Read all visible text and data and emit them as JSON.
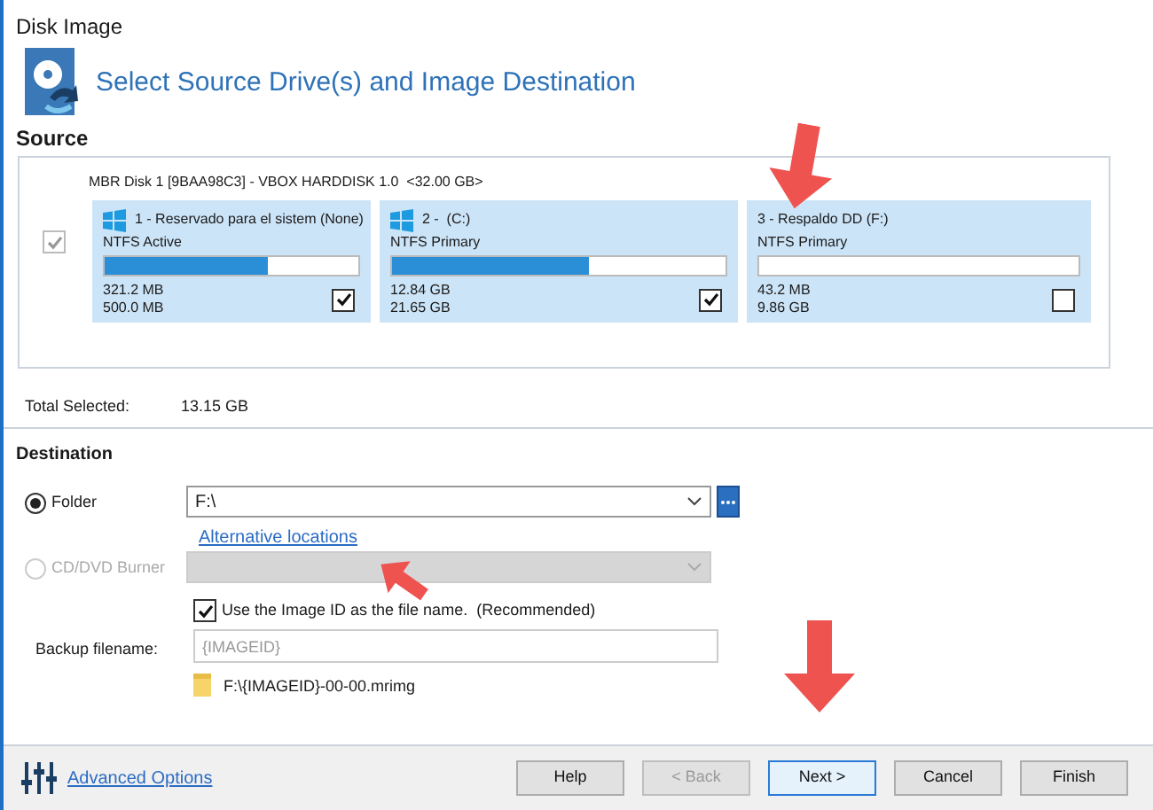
{
  "window": {
    "title": "Disk Image"
  },
  "heading": "Select Source Drive(s) and Image Destination",
  "source": {
    "title": "Source",
    "disk": {
      "label": "MBR Disk 1 [9BAA98C3] - VBOX HARDDISK 1.0  <32.00 GB>",
      "checked": true,
      "disabled": true
    },
    "partitions": [
      {
        "kind": "windows",
        "name": "1 - Reservado para el sistem (None)",
        "type": "NTFS Active",
        "level": 0.64,
        "used": "321.2 MB",
        "total": "500.0 MB",
        "checked": true
      },
      {
        "kind": "windows",
        "name": "2 -  (C:)",
        "type": "NTFS Primary",
        "level": 0.59,
        "used": "12.84 GB",
        "total": "21.65 GB",
        "checked": true
      },
      {
        "kind": "plain",
        "name": "3 - Respaldo DD (F:)",
        "type": "NTFS Primary",
        "level": 0.0,
        "used": "43.2 MB",
        "total": "9.86 GB",
        "checked": false
      }
    ],
    "total_label": "Total Selected:",
    "total_value": "13.15 GB"
  },
  "destination": {
    "title": "Destination",
    "options": [
      {
        "label": "Folder",
        "selected": true,
        "disabled": false,
        "value": "F:\\"
      },
      {
        "label": "CD/DVD Burner",
        "selected": false,
        "disabled": true
      }
    ],
    "link": "Alternative locations",
    "use_image_id": {
      "label": "Use the Image ID as the file name.  (Recommended)",
      "checked": true
    },
    "filename_label": "Backup filename:",
    "filename_placeholder": "{IMAGEID}",
    "path": "F:\\{IMAGEID}-00-00.mrimg"
  },
  "footer": {
    "advanced": "Advanced Options",
    "buttons": [
      {
        "label": "Help",
        "disabled": false,
        "selected": false
      },
      {
        "label": "< Back",
        "disabled": true,
        "selected": false
      },
      {
        "label": "Next >",
        "disabled": false,
        "selected": true
      },
      {
        "label": "Cancel",
        "disabled": false,
        "selected": false
      },
      {
        "label": "Finish",
        "disabled": false,
        "selected": false
      }
    ]
  }
}
